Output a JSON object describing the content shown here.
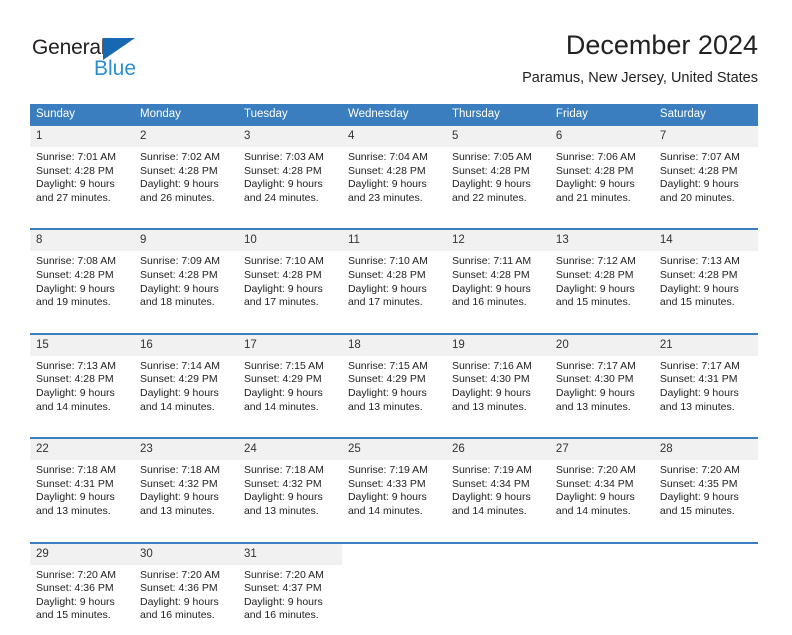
{
  "brand": {
    "name_part1": "General",
    "name_part2": "Blue",
    "triangle_color": "#1668b3",
    "blue_color": "#2b8fd4",
    "dark_color": "#231f20"
  },
  "header": {
    "title": "December 2024",
    "subtitle": "Paramus, New Jersey, United States"
  },
  "theme": {
    "header_blue": "#3a7ebf",
    "daynum_bg": "#f1f1f1",
    "text": "#222222"
  },
  "weekdays": [
    "Sunday",
    "Monday",
    "Tuesday",
    "Wednesday",
    "Thursday",
    "Friday",
    "Saturday"
  ],
  "weeks": [
    [
      {
        "day": "1",
        "sunrise": "Sunrise: 7:01 AM",
        "sunset": "Sunset: 4:28 PM",
        "daylight1": "Daylight: 9 hours",
        "daylight2": "and 27 minutes."
      },
      {
        "day": "2",
        "sunrise": "Sunrise: 7:02 AM",
        "sunset": "Sunset: 4:28 PM",
        "daylight1": "Daylight: 9 hours",
        "daylight2": "and 26 minutes."
      },
      {
        "day": "3",
        "sunrise": "Sunrise: 7:03 AM",
        "sunset": "Sunset: 4:28 PM",
        "daylight1": "Daylight: 9 hours",
        "daylight2": "and 24 minutes."
      },
      {
        "day": "4",
        "sunrise": "Sunrise: 7:04 AM",
        "sunset": "Sunset: 4:28 PM",
        "daylight1": "Daylight: 9 hours",
        "daylight2": "and 23 minutes."
      },
      {
        "day": "5",
        "sunrise": "Sunrise: 7:05 AM",
        "sunset": "Sunset: 4:28 PM",
        "daylight1": "Daylight: 9 hours",
        "daylight2": "and 22 minutes."
      },
      {
        "day": "6",
        "sunrise": "Sunrise: 7:06 AM",
        "sunset": "Sunset: 4:28 PM",
        "daylight1": "Daylight: 9 hours",
        "daylight2": "and 21 minutes."
      },
      {
        "day": "7",
        "sunrise": "Sunrise: 7:07 AM",
        "sunset": "Sunset: 4:28 PM",
        "daylight1": "Daylight: 9 hours",
        "daylight2": "and 20 minutes."
      }
    ],
    [
      {
        "day": "8",
        "sunrise": "Sunrise: 7:08 AM",
        "sunset": "Sunset: 4:28 PM",
        "daylight1": "Daylight: 9 hours",
        "daylight2": "and 19 minutes."
      },
      {
        "day": "9",
        "sunrise": "Sunrise: 7:09 AM",
        "sunset": "Sunset: 4:28 PM",
        "daylight1": "Daylight: 9 hours",
        "daylight2": "and 18 minutes."
      },
      {
        "day": "10",
        "sunrise": "Sunrise: 7:10 AM",
        "sunset": "Sunset: 4:28 PM",
        "daylight1": "Daylight: 9 hours",
        "daylight2": "and 17 minutes."
      },
      {
        "day": "11",
        "sunrise": "Sunrise: 7:10 AM",
        "sunset": "Sunset: 4:28 PM",
        "daylight1": "Daylight: 9 hours",
        "daylight2": "and 17 minutes."
      },
      {
        "day": "12",
        "sunrise": "Sunrise: 7:11 AM",
        "sunset": "Sunset: 4:28 PM",
        "daylight1": "Daylight: 9 hours",
        "daylight2": "and 16 minutes."
      },
      {
        "day": "13",
        "sunrise": "Sunrise: 7:12 AM",
        "sunset": "Sunset: 4:28 PM",
        "daylight1": "Daylight: 9 hours",
        "daylight2": "and 15 minutes."
      },
      {
        "day": "14",
        "sunrise": "Sunrise: 7:13 AM",
        "sunset": "Sunset: 4:28 PM",
        "daylight1": "Daylight: 9 hours",
        "daylight2": "and 15 minutes."
      }
    ],
    [
      {
        "day": "15",
        "sunrise": "Sunrise: 7:13 AM",
        "sunset": "Sunset: 4:28 PM",
        "daylight1": "Daylight: 9 hours",
        "daylight2": "and 14 minutes."
      },
      {
        "day": "16",
        "sunrise": "Sunrise: 7:14 AM",
        "sunset": "Sunset: 4:29 PM",
        "daylight1": "Daylight: 9 hours",
        "daylight2": "and 14 minutes."
      },
      {
        "day": "17",
        "sunrise": "Sunrise: 7:15 AM",
        "sunset": "Sunset: 4:29 PM",
        "daylight1": "Daylight: 9 hours",
        "daylight2": "and 14 minutes."
      },
      {
        "day": "18",
        "sunrise": "Sunrise: 7:15 AM",
        "sunset": "Sunset: 4:29 PM",
        "daylight1": "Daylight: 9 hours",
        "daylight2": "and 13 minutes."
      },
      {
        "day": "19",
        "sunrise": "Sunrise: 7:16 AM",
        "sunset": "Sunset: 4:30 PM",
        "daylight1": "Daylight: 9 hours",
        "daylight2": "and 13 minutes."
      },
      {
        "day": "20",
        "sunrise": "Sunrise: 7:17 AM",
        "sunset": "Sunset: 4:30 PM",
        "daylight1": "Daylight: 9 hours",
        "daylight2": "and 13 minutes."
      },
      {
        "day": "21",
        "sunrise": "Sunrise: 7:17 AM",
        "sunset": "Sunset: 4:31 PM",
        "daylight1": "Daylight: 9 hours",
        "daylight2": "and 13 minutes."
      }
    ],
    [
      {
        "day": "22",
        "sunrise": "Sunrise: 7:18 AM",
        "sunset": "Sunset: 4:31 PM",
        "daylight1": "Daylight: 9 hours",
        "daylight2": "and 13 minutes."
      },
      {
        "day": "23",
        "sunrise": "Sunrise: 7:18 AM",
        "sunset": "Sunset: 4:32 PM",
        "daylight1": "Daylight: 9 hours",
        "daylight2": "and 13 minutes."
      },
      {
        "day": "24",
        "sunrise": "Sunrise: 7:18 AM",
        "sunset": "Sunset: 4:32 PM",
        "daylight1": "Daylight: 9 hours",
        "daylight2": "and 13 minutes."
      },
      {
        "day": "25",
        "sunrise": "Sunrise: 7:19 AM",
        "sunset": "Sunset: 4:33 PM",
        "daylight1": "Daylight: 9 hours",
        "daylight2": "and 14 minutes."
      },
      {
        "day": "26",
        "sunrise": "Sunrise: 7:19 AM",
        "sunset": "Sunset: 4:34 PM",
        "daylight1": "Daylight: 9 hours",
        "daylight2": "and 14 minutes."
      },
      {
        "day": "27",
        "sunrise": "Sunrise: 7:20 AM",
        "sunset": "Sunset: 4:34 PM",
        "daylight1": "Daylight: 9 hours",
        "daylight2": "and 14 minutes."
      },
      {
        "day": "28",
        "sunrise": "Sunrise: 7:20 AM",
        "sunset": "Sunset: 4:35 PM",
        "daylight1": "Daylight: 9 hours",
        "daylight2": "and 15 minutes."
      }
    ],
    [
      {
        "day": "29",
        "sunrise": "Sunrise: 7:20 AM",
        "sunset": "Sunset: 4:36 PM",
        "daylight1": "Daylight: 9 hours",
        "daylight2": "and 15 minutes."
      },
      {
        "day": "30",
        "sunrise": "Sunrise: 7:20 AM",
        "sunset": "Sunset: 4:36 PM",
        "daylight1": "Daylight: 9 hours",
        "daylight2": "and 16 minutes."
      },
      {
        "day": "31",
        "sunrise": "Sunrise: 7:20 AM",
        "sunset": "Sunset: 4:37 PM",
        "daylight1": "Daylight: 9 hours",
        "daylight2": "and 16 minutes."
      },
      {
        "day": "",
        "sunrise": "",
        "sunset": "",
        "daylight1": "",
        "daylight2": ""
      },
      {
        "day": "",
        "sunrise": "",
        "sunset": "",
        "daylight1": "",
        "daylight2": ""
      },
      {
        "day": "",
        "sunrise": "",
        "sunset": "",
        "daylight1": "",
        "daylight2": ""
      },
      {
        "day": "",
        "sunrise": "",
        "sunset": "",
        "daylight1": "",
        "daylight2": ""
      }
    ]
  ]
}
